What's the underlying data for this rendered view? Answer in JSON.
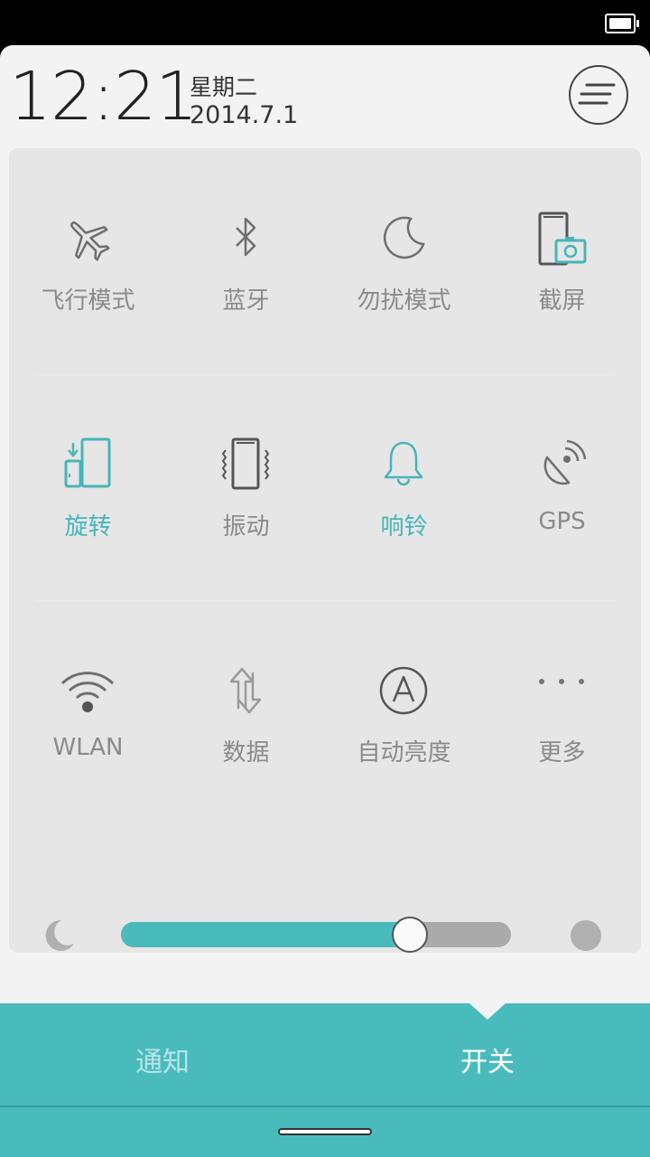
{
  "header": {
    "time": "12:21",
    "weekday": "星期二",
    "date": "2014.7.1"
  },
  "toggles": [
    {
      "id": "airplane",
      "label": "飞行模式",
      "icon": "airplane-icon",
      "active": false
    },
    {
      "id": "bluetooth",
      "label": "蓝牙",
      "icon": "bluetooth-icon",
      "active": false
    },
    {
      "id": "dnd",
      "label": "勿扰模式",
      "icon": "moon-icon",
      "active": false
    },
    {
      "id": "screenshot",
      "label": "截屏",
      "icon": "screenshot-icon",
      "active": false
    },
    {
      "id": "rotate",
      "label": "旋转",
      "icon": "rotate-icon",
      "active": true
    },
    {
      "id": "vibrate",
      "label": "振动",
      "icon": "vibrate-icon",
      "active": false
    },
    {
      "id": "ring",
      "label": "响铃",
      "icon": "bell-icon",
      "active": true
    },
    {
      "id": "gps",
      "label": "GPS",
      "icon": "gps-icon",
      "active": false
    },
    {
      "id": "wlan",
      "label": "WLAN",
      "icon": "wifi-icon",
      "active": false
    },
    {
      "id": "data",
      "label": "数据",
      "icon": "data-icon",
      "active": false
    },
    {
      "id": "auto-brightness",
      "label": "自动亮度",
      "icon": "auto-brightness-icon",
      "active": false
    },
    {
      "id": "more",
      "label": "更多",
      "icon": "more-icon",
      "active": false
    }
  ],
  "brightness": {
    "level": 0.74
  },
  "tabs": {
    "notify": "通知",
    "switch": "开关",
    "active": "switch"
  },
  "colors": {
    "accent": "#4abbbd",
    "inactive": "#8a8a8a",
    "tabbar": "#4abbbd"
  }
}
